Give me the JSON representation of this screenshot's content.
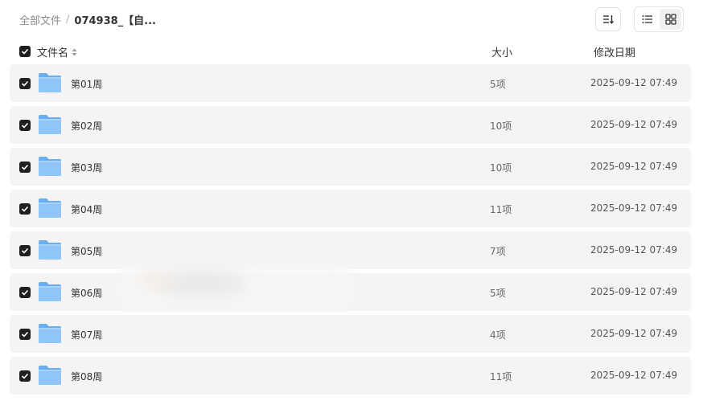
{
  "breadcrumb": {
    "root": "全部文件",
    "separator": "/",
    "current": "074938_【自..."
  },
  "toolbar": {
    "sort_icon": "sort-icon",
    "list_view_icon": "list-view-icon",
    "grid_view_icon": "grid-view-icon",
    "active_view": "grid"
  },
  "table": {
    "columns": {
      "name": "文件名",
      "size": "大小",
      "date": "修改日期"
    },
    "all_selected": true,
    "rows": [
      {
        "name": "第01周",
        "size": "5项",
        "date": "2025-09-12 07:49",
        "selected": true
      },
      {
        "name": "第02周",
        "size": "10项",
        "date": "2025-09-12 07:49",
        "selected": true
      },
      {
        "name": "第03周",
        "size": "10项",
        "date": "2025-09-12 07:49",
        "selected": true
      },
      {
        "name": "第04周",
        "size": "11项",
        "date": "2025-09-12 07:49",
        "selected": true
      },
      {
        "name": "第05周",
        "size": "7项",
        "date": "2025-09-12 07:49",
        "selected": true
      },
      {
        "name": "第06周",
        "size": "5项",
        "date": "2025-09-12 07:49",
        "selected": true
      },
      {
        "name": "第07周",
        "size": "4项",
        "date": "2025-09-12 07:49",
        "selected": true
      },
      {
        "name": "第08周",
        "size": "11项",
        "date": "2025-09-12 07:49",
        "selected": true
      }
    ]
  },
  "colors": {
    "row_bg": "#f4f4f4",
    "checkbox": "#1f1f1f",
    "folder_front": "#8fc6f7",
    "folder_back": "#6aaef0"
  }
}
